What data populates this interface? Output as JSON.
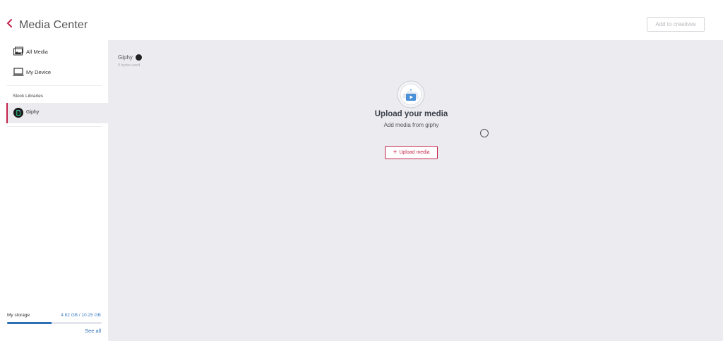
{
  "header": {
    "title": "Media Center",
    "add_button_label": "Add to creatives"
  },
  "sidebar": {
    "items": [
      {
        "label": "All Media",
        "icon": "images-icon"
      },
      {
        "label": "My Device",
        "icon": "laptop-icon"
      }
    ],
    "section_label": "Stock Libraries",
    "libraries": [
      {
        "label": "Giphy",
        "icon": "giphy-logo-icon",
        "active": true
      }
    ],
    "storage": {
      "label": "My storage",
      "value": "4.82 GB / 10.25 GB",
      "fraction": 0.47,
      "see_all_label": "See all"
    }
  },
  "main": {
    "library_name": "Giphy",
    "usage": "0 bytes used",
    "empty_title": "Upload your media",
    "empty_subtitle": "Add media from giphy",
    "upload_button_label": "Upload media"
  },
  "colors": {
    "accent": "#c2234a",
    "link": "#2b6fb5",
    "main_bg": "#ececf0"
  }
}
